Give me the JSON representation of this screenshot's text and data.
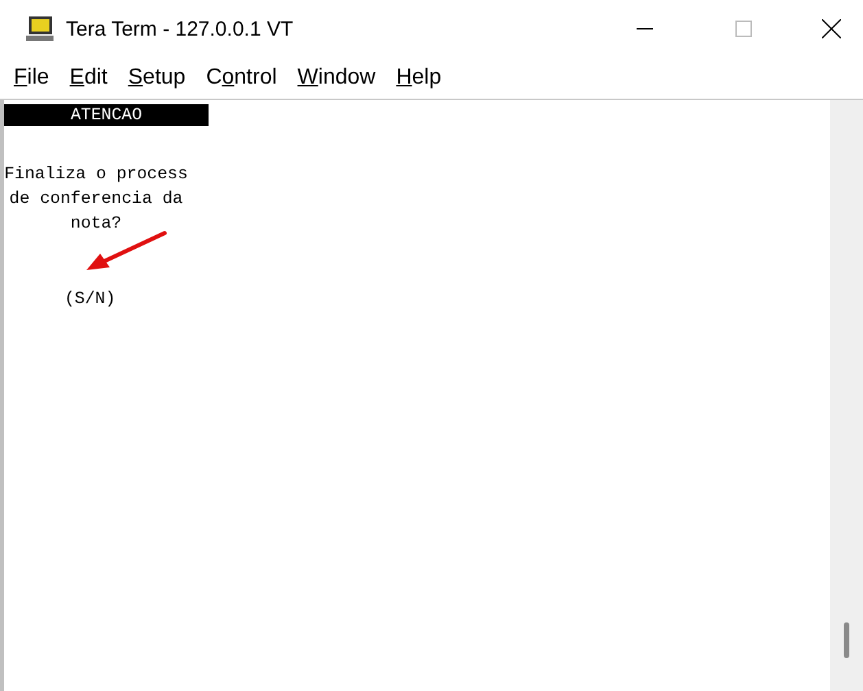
{
  "window": {
    "title": "Tera Term - 127.0.0.1 VT"
  },
  "menu": [
    {
      "access_key": "F",
      "after": "ile"
    },
    {
      "access_key": "E",
      "after": "dit"
    },
    {
      "access_key": "S",
      "after": "etup"
    },
    {
      "before": "C",
      "access_key": "o",
      "after": "ntrol"
    },
    {
      "access_key": "W",
      "after": "indow"
    },
    {
      "access_key": "H",
      "after": "elp"
    }
  ],
  "terminal": {
    "header": "ATENCAO",
    "message": [
      "Finaliza o process",
      "de conferencia da",
      "nota?"
    ],
    "prompt": "(S/N)"
  }
}
